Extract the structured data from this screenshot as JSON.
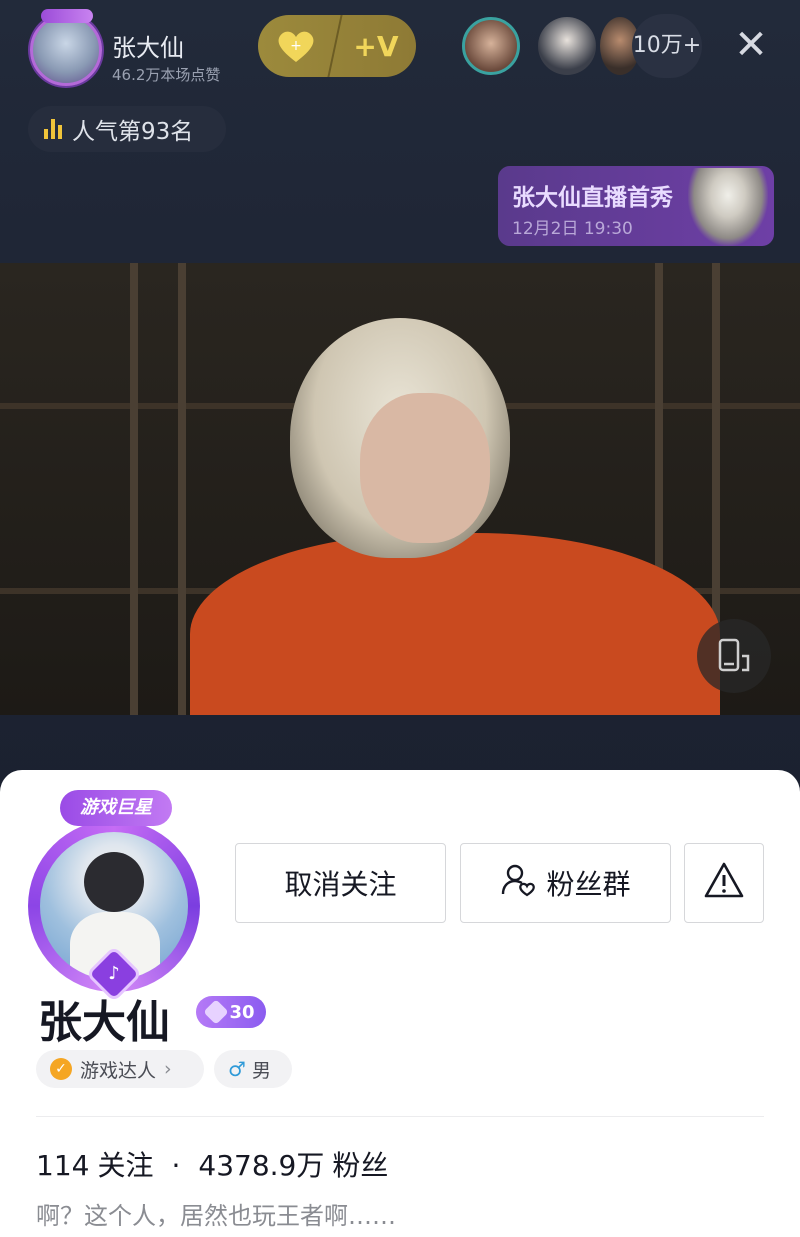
{
  "topbar": {
    "host_name": "张大仙",
    "host_likes": "46.2万本场点赞",
    "viewer_count": "10万+",
    "close_glyph": "✕",
    "gift_plus_v": "+V"
  },
  "rank": {
    "label": "人气第93名"
  },
  "promo": {
    "title": "张大仙直播首秀",
    "time": "12月2日 19:30"
  },
  "profile": {
    "avatar_badge": "游戏巨星",
    "unfollow_label": "取消关注",
    "fans_group_label": "粉丝群",
    "name": "张大仙",
    "level": "30",
    "tags": {
      "game": "游戏达人",
      "gender": "男"
    },
    "following_count": "114",
    "following_label": "关注",
    "followers_count": "4378.9万",
    "followers_label": "粉丝",
    "bio": "啊？这个人，居然也玩王者啊……"
  },
  "icons": [
    "close-icon",
    "heart-gift-icon",
    "popularity-bars-icon",
    "rotate-screen-icon",
    "fans-group-icon",
    "report-warning-icon",
    "verified-check-icon",
    "male-icon",
    "chevron-right-icon",
    "douyin-logo-icon"
  ],
  "colors": {
    "accent_purple": "#8b5cf0",
    "gold": "#f1d65a",
    "shirt": "#c94a1f"
  }
}
